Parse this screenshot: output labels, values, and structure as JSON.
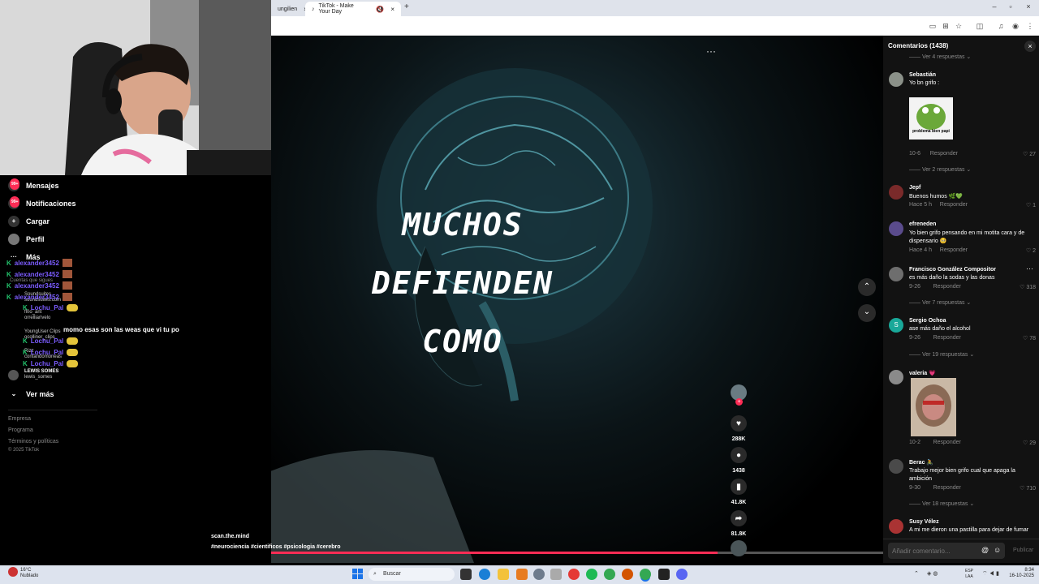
{
  "browser": {
    "tabs": [
      {
        "title": "ungilien",
        "close": "×"
      },
      {
        "title": "TikTok - Make Your Day",
        "close": "×"
      }
    ],
    "new_tab": "+",
    "window_controls": [
      "–",
      "▫",
      "×"
    ]
  },
  "sidebar": {
    "items": [
      {
        "label": "Mensajes",
        "icon": "paper-plane-icon",
        "badge": "99+"
      },
      {
        "label": "Notificaciones",
        "icon": "inbox-icon",
        "badge": "99+"
      },
      {
        "label": "Cargar",
        "icon": "upload-icon"
      },
      {
        "label": "Perfil",
        "icon": "profile-icon"
      },
      {
        "label": "Más",
        "icon": "more-icon"
      }
    ],
    "see_more": "Ver más",
    "followed_label": "Cuentas que sigues",
    "followed": [
      {
        "name": "Soundsuites",
        "handle": "soundsuites.com"
      },
      {
        "name": "fl0o_ant",
        "handle": "orrelliarivelo"
      },
      {
        "name": "YoungUser Clips",
        "handle": "ocolliner_clips"
      },
      {
        "name": "Rizz",
        "handle": "contandomoneas"
      },
      {
        "name": "LEWIS SOMES",
        "handle": "lewis_somes"
      }
    ],
    "footer": [
      "Empresa",
      "Programa",
      "Términos y políticas",
      "© 2025 TikTok"
    ]
  },
  "chat_overlay": [
    {
      "user": "alexander3452",
      "text": ""
    },
    {
      "user": "alexander3452",
      "text": ""
    },
    {
      "user": "alexander3452",
      "text": ""
    },
    {
      "user": "alexander3452",
      "text": ""
    },
    {
      "user": "Lochu_Pal",
      "text": ""
    },
    {
      "user": "",
      "text": "momo esas son las weas que vi tu po"
    },
    {
      "user": "Lochu_Pal",
      "text": ""
    },
    {
      "user": "Lochu_Pal",
      "text": ""
    },
    {
      "user": "Lochu_Pal",
      "text": ""
    }
  ],
  "video": {
    "words": [
      "MUCHOS",
      "DEFIENDEN",
      "COMO"
    ],
    "author": "scan.the.mind",
    "hashtags": "#neurociencia #cientificos #psicologia #cerebro",
    "more": "···",
    "actions": [
      {
        "icon": "heart-icon",
        "count": "288K"
      },
      {
        "icon": "comment-icon",
        "count": "1438"
      },
      {
        "icon": "bookmark-icon",
        "count": "41.8K"
      },
      {
        "icon": "share-icon",
        "count": "81.8K"
      }
    ],
    "progress": 0.83
  },
  "comments": {
    "title": "Comentarios (1438)",
    "close": "×",
    "input_placeholder": "Añadir comentario...",
    "publish": "Publicar",
    "reply_label": "Responder",
    "items": [
      {
        "name": "",
        "text": "",
        "replies": "Ver 4 respuestas"
      },
      {
        "name": "Sebastián",
        "text": "Yo bn grifo :",
        "meta": "10-6",
        "likes": "27",
        "image": "problema bien papi",
        "replies": "Ver 2 respuestas"
      },
      {
        "name": "Jepf",
        "text": "Buenos humos 🌿💚",
        "meta": "Hace 5 h",
        "likes": "1"
      },
      {
        "name": "efreneden",
        "text": "Yo bien grifo pensando en mi motita cara y de dispensario 🥺",
        "meta": "Hace 4 h",
        "likes": "2"
      },
      {
        "name": "Francisco González Compositor",
        "text": "es más daño la sodas y las donas",
        "meta": "9-26",
        "likes": "318",
        "replies": "Ver 7 respuestas"
      },
      {
        "name": "Sergio Ochoa",
        "text": "ase más daño el alcohol",
        "meta": "9-26",
        "likes": "78",
        "replies": "Ver 19 respuestas"
      },
      {
        "name": "valeria 💗",
        "text": "",
        "meta": "10-2",
        "likes": "29"
      },
      {
        "name": "Berac 🚴",
        "text": "Trabajo mejor bien grifo cual que apaga la ambición",
        "meta": "9-30",
        "likes": "710",
        "replies": "Ver 18 respuestas"
      },
      {
        "name": "Susy Vélez",
        "text": "A mi me dieron una pastilla para dejar de fumar"
      }
    ]
  },
  "taskbar": {
    "weather": "16°C",
    "weather_desc": "Nublado",
    "search": "Buscar",
    "lang": "ESP",
    "lang2": "LAA",
    "time": "8:34",
    "date": "16-10-2025"
  },
  "colors": {
    "accent": "#fe2c55",
    "chat_user": "#7b5cff",
    "green": "#23c16b"
  }
}
